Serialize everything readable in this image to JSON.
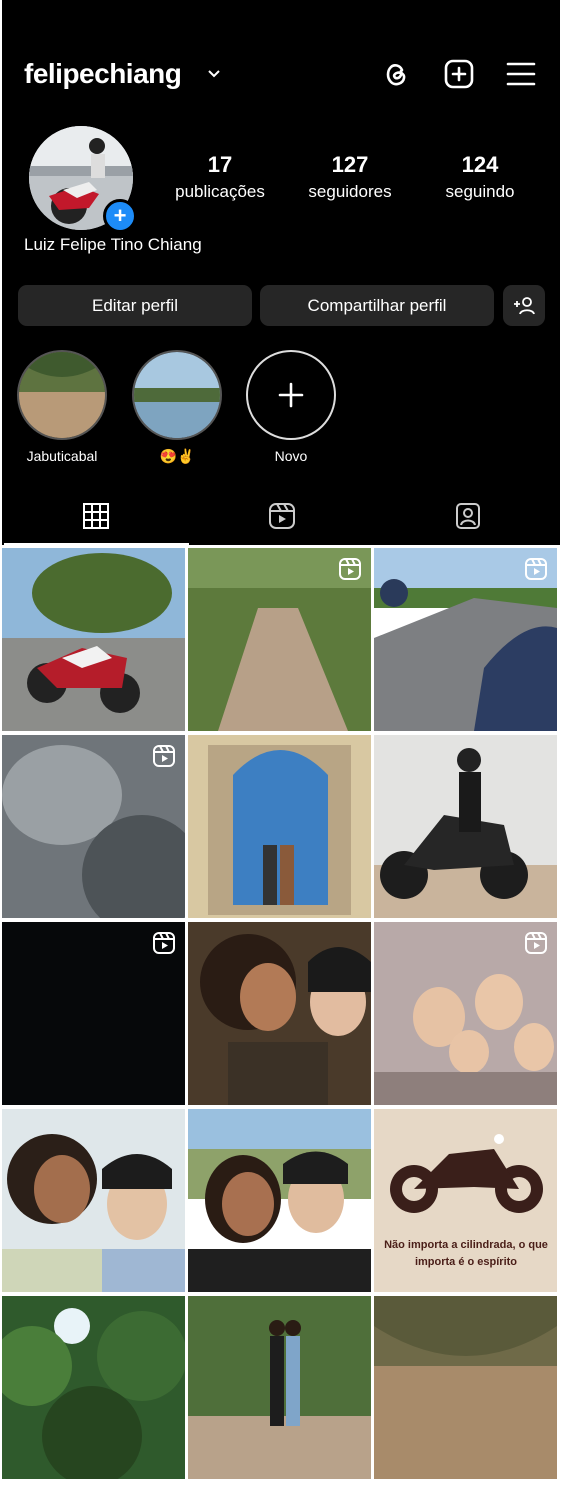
{
  "header": {
    "username": "felipechiang"
  },
  "stats": [
    {
      "value": "17",
      "label": "publicações"
    },
    {
      "value": "127",
      "label": "seguidores"
    },
    {
      "value": "124",
      "label": "seguindo"
    }
  ],
  "profile": {
    "full_name": "Luiz Felipe Tino Chiang"
  },
  "buttons": {
    "edit": "Editar perfil",
    "share": "Compartilhar perfil"
  },
  "highlights": [
    {
      "label": "Jabuticabal"
    },
    {
      "label": "😍✌"
    },
    {
      "label": "Novo"
    }
  ],
  "grid": {
    "posts": [
      {
        "type": "photo"
      },
      {
        "type": "reel"
      },
      {
        "type": "reel"
      },
      {
        "type": "reel"
      },
      {
        "type": "photo"
      },
      {
        "type": "photo"
      },
      {
        "type": "reel"
      },
      {
        "type": "photo"
      },
      {
        "type": "reel"
      },
      {
        "type": "photo",
        "text": ""
      },
      {
        "type": "photo"
      },
      {
        "type": "photo",
        "text": "Não importa a cilindrada, o que importa é o espírito"
      },
      {
        "type": "photo"
      },
      {
        "type": "photo"
      },
      {
        "type": "photo"
      }
    ]
  },
  "icons": [
    "chevron-down-icon",
    "threads-icon",
    "new-post-icon",
    "menu-icon",
    "add-person-icon",
    "grid-icon",
    "reels-icon",
    "tagged-icon",
    "reel-badge-icon"
  ]
}
